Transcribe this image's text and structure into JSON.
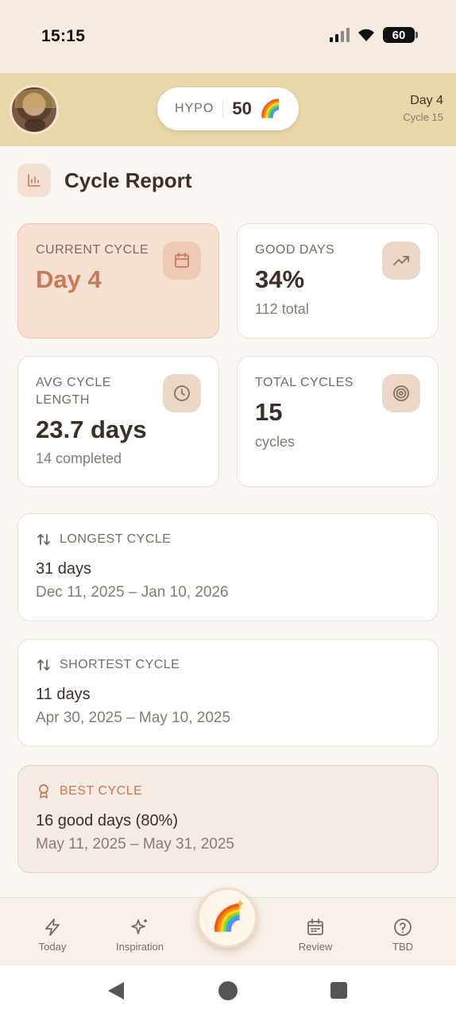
{
  "status_bar": {
    "time": "15:15",
    "battery": "60"
  },
  "header": {
    "avatar_alt": "User avatar",
    "score_label": "HYPO",
    "score_value": "50",
    "score_emoji": "🌈",
    "day": "Day 4",
    "cycle": "Cycle 15"
  },
  "page": {
    "title": "Cycle Report"
  },
  "stats": [
    {
      "label": "CURRENT CYCLE",
      "value": "Day 4",
      "sub": "",
      "icon": "calendar-icon"
    },
    {
      "label": "GOOD DAYS",
      "value": "34%",
      "sub": "112 total",
      "icon": "trending-up-icon"
    },
    {
      "label": "AVG CYCLE LENGTH",
      "value": "23.7 days",
      "sub": "14 completed",
      "icon": "clock-icon"
    },
    {
      "label": "TOTAL CYCLES",
      "value": "15",
      "sub": "cycles",
      "icon": "target-icon"
    }
  ],
  "longest": {
    "label": "LONGEST CYCLE",
    "value": "31 days",
    "range": "Dec 11, 2025 – Jan 10, 2026"
  },
  "shortest": {
    "label": "SHORTEST CYCLE",
    "value": "11 days",
    "range": "Apr 30, 2025 – May 10, 2025"
  },
  "best": {
    "label": "BEST CYCLE",
    "value": "16 good days (80%)",
    "range": "May 11, 2025 – May 31, 2025"
  },
  "nav": {
    "today": "Today",
    "inspiration": "Inspiration",
    "center_emoji": "🌈",
    "review": "Review",
    "tbd": "TBD"
  },
  "colors": {
    "accent": "#c77a55",
    "header_bg": "#e8d7a8",
    "page_bg": "#faf6f1"
  }
}
